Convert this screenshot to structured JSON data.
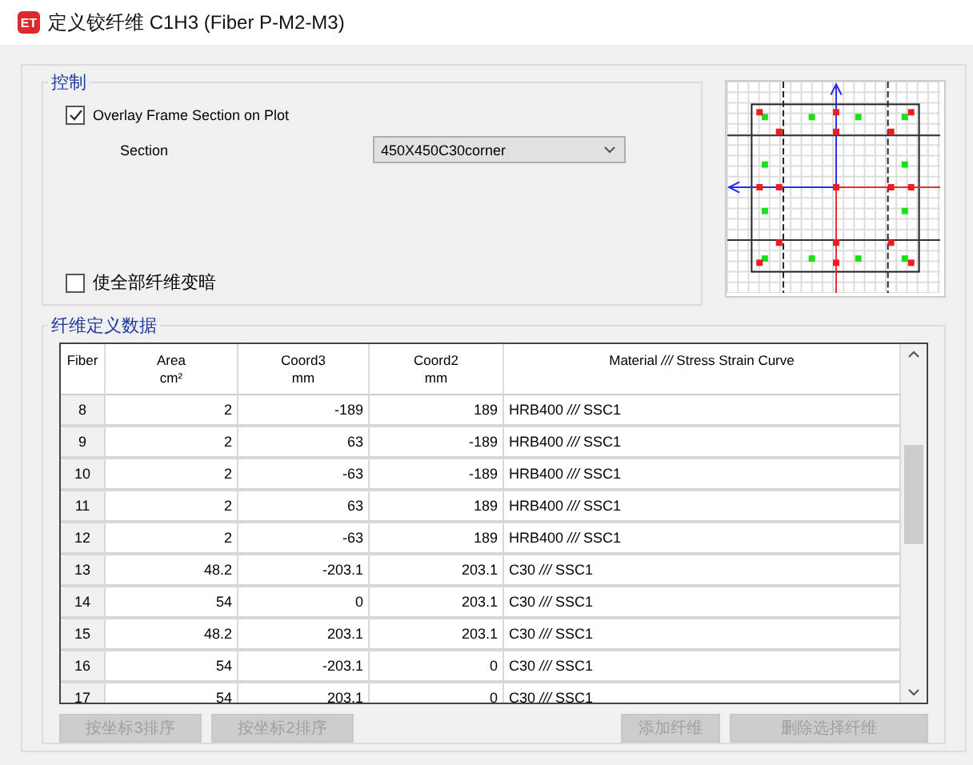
{
  "window": {
    "app_icon": "ET",
    "title": "定义铰纤维 C1H3  (Fiber P-M2-M3)"
  },
  "control": {
    "title": "控制",
    "overlay": {
      "label": "Overlay Frame Section on Plot",
      "checked": true
    },
    "section": {
      "label": "Section",
      "value": "450X450C30corner"
    },
    "dim_all": {
      "label": "使全部纤维变暗",
      "checked": false
    }
  },
  "fiber_data": {
    "title": "纤维定义数据",
    "columns": [
      {
        "name": "Fiber"
      },
      {
        "name": "Area",
        "unit": "cm²"
      },
      {
        "name": "Coord3",
        "unit": "mm"
      },
      {
        "name": "Coord2",
        "unit": "mm"
      },
      {
        "name": "Material *///* Stress Strain Curve"
      }
    ],
    "rows": [
      {
        "fiber": "8",
        "area": "2",
        "coord3": "-189",
        "coord2": "189",
        "material": "HRB400 *///* SSC1"
      },
      {
        "fiber": "9",
        "area": "2",
        "coord3": "63",
        "coord2": "-189",
        "material": "HRB400 *///* SSC1"
      },
      {
        "fiber": "10",
        "area": "2",
        "coord3": "-63",
        "coord2": "-189",
        "material": "HRB400 *///* SSC1"
      },
      {
        "fiber": "11",
        "area": "2",
        "coord3": "63",
        "coord2": "189",
        "material": "HRB400 *///* SSC1"
      },
      {
        "fiber": "12",
        "area": "2",
        "coord3": "-63",
        "coord2": "189",
        "material": "HRB400 *///* SSC1"
      },
      {
        "fiber": "13",
        "area": "48.2",
        "coord3": "-203.1",
        "coord2": "203.1",
        "material": "C30 *///* SSC1"
      },
      {
        "fiber": "14",
        "area": "54",
        "coord3": "0",
        "coord2": "203.1",
        "material": "C30 *///* SSC1"
      },
      {
        "fiber": "15",
        "area": "48.2",
        "coord3": "203.1",
        "coord2": "203.1",
        "material": "C30 *///* SSC1"
      },
      {
        "fiber": "16",
        "area": "54",
        "coord3": "-203.1",
        "coord2": "0",
        "material": "C30 *///* SSC1"
      },
      {
        "fiber": "17",
        "area": "54",
        "coord3": "203.1",
        "coord2": "0",
        "material": "C30 *///* SSC1"
      }
    ]
  },
  "buttons": [
    {
      "label": "按坐标3排序",
      "disabled": true
    },
    {
      "label": "按坐标2排序",
      "disabled": true
    },
    {
      "label": "添加纤维",
      "disabled": true
    },
    {
      "label": "删除选择纤维",
      "disabled": true
    }
  ]
}
